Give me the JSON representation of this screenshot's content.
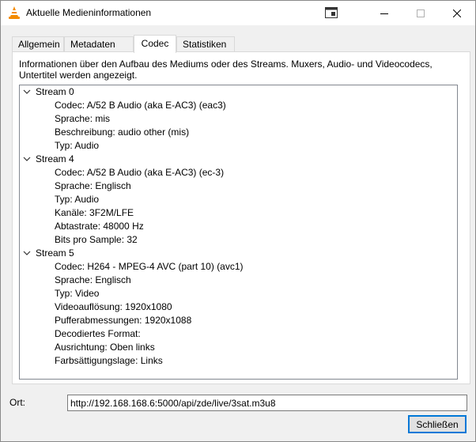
{
  "window": {
    "title": "Aktuelle Medieninformationen",
    "icon": "vlc-cone-icon"
  },
  "tabs": [
    {
      "label": "Allgemein",
      "active": false
    },
    {
      "label": "Metadaten",
      "active": false
    },
    {
      "label": "Codec",
      "active": true
    },
    {
      "label": "Statistiken",
      "active": false
    }
  ],
  "codec": {
    "description": "Informationen über den Aufbau des Mediums oder des Streams. Muxers, Audio- und Videocodecs, Untertitel werden angezeigt.",
    "streams": [
      {
        "label": "Stream 0",
        "properties": [
          "Codec: A/52 B Audio (aka E-AC3) (eac3)",
          "Sprache: mis",
          "Beschreibung: audio other (mis)",
          "Typ: Audio"
        ]
      },
      {
        "label": "Stream 4",
        "properties": [
          "Codec: A/52 B Audio (aka E-AC3) (ec-3)",
          "Sprache: Englisch",
          "Typ: Audio",
          "Kanäle: 3F2M/LFE",
          "Abtastrate: 48000 Hz",
          "Bits pro Sample: 32"
        ]
      },
      {
        "label": "Stream 5",
        "properties": [
          "Codec: H264 - MPEG-4 AVC (part 10) (avc1)",
          "Sprache: Englisch",
          "Typ: Video",
          "Videoauflösung: 1920x1080",
          "Pufferabmessungen: 1920x1088",
          "Decodiertes Format:",
          "Ausrichtung: Oben links",
          "Farbsättigungslage: Links"
        ]
      }
    ]
  },
  "footer": {
    "location_label": "Ort:",
    "location_value": "http://192.168.168.6:5000/api/zde/live/3sat.m3u8",
    "close_label": "Schließen"
  }
}
